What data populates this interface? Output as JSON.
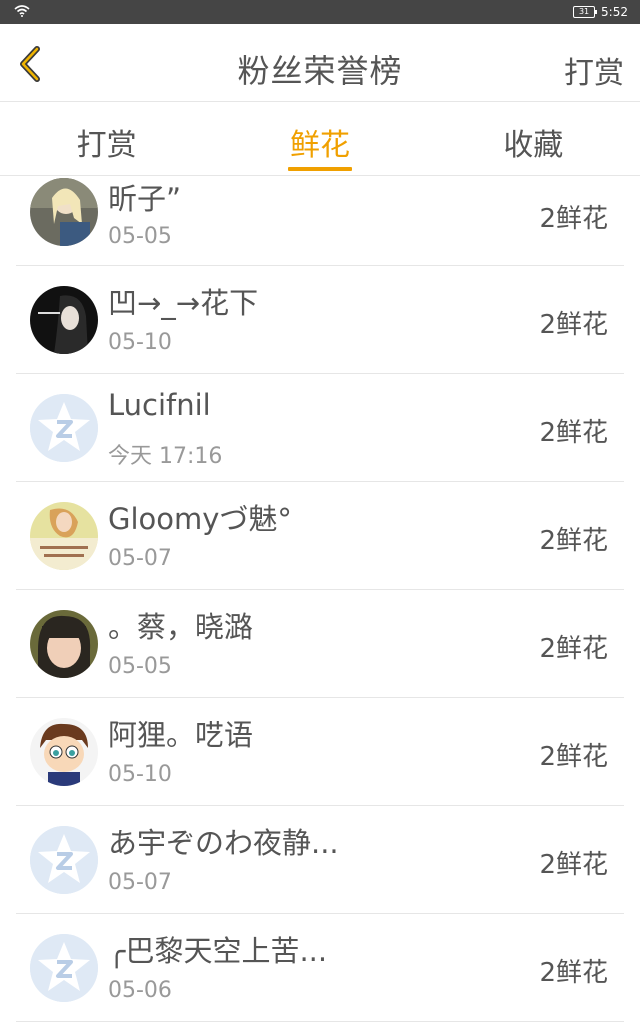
{
  "status": {
    "battery": "31",
    "time": "5:52"
  },
  "header": {
    "title": "粉丝荣誉榜",
    "action": "打赏"
  },
  "tabs": [
    {
      "label": "打赏",
      "active": false
    },
    {
      "label": "鲜花",
      "active": true
    },
    {
      "label": "收藏",
      "active": false
    }
  ],
  "fans": [
    {
      "name": "昕子”",
      "date": "05-05",
      "count": "2鲜花",
      "avatar": "photo"
    },
    {
      "name": "凹→_→花下",
      "date": "05-10",
      "count": "2鲜花",
      "avatar": "photo"
    },
    {
      "name": "Lucifnil",
      "date": "今天 17:16",
      "count": "2鲜花",
      "avatar": "default"
    },
    {
      "name": "Gloomyづ魅°",
      "date": "05-07",
      "count": "2鲜花",
      "avatar": "photo"
    },
    {
      "name": "。蔡，晓潞",
      "date": "05-05",
      "count": "2鲜花",
      "avatar": "photo"
    },
    {
      "name": "阿狸。呓语",
      "date": "05-10",
      "count": "2鲜花",
      "avatar": "cartoon"
    },
    {
      "name": "あ宇ぞのわ夜静...",
      "date": "05-07",
      "count": "2鲜花",
      "avatar": "default"
    },
    {
      "name": "╭巴黎天空上苦...",
      "date": "05-06",
      "count": "2鲜花",
      "avatar": "default"
    }
  ],
  "colors": {
    "accent": "#f0a000",
    "status_bar": "#454545",
    "default_avatar": "#dfe9f5"
  }
}
